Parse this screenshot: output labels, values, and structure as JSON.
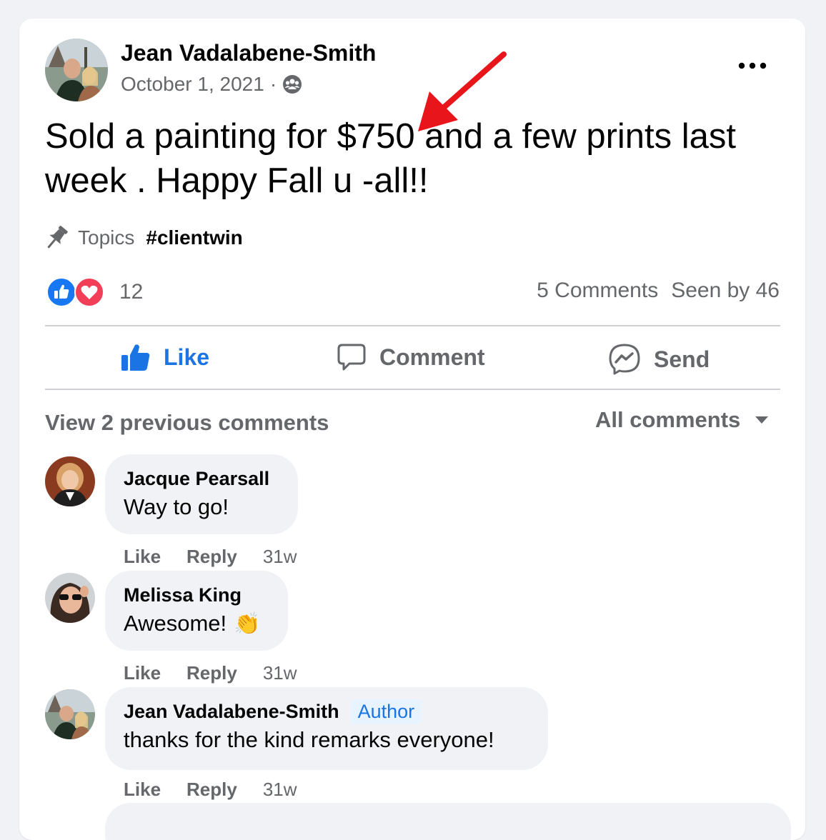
{
  "post": {
    "author": "Jean Vadalabene-Smith",
    "date": "October 1, 2021",
    "separator": "·",
    "privacy_icon": "group-icon",
    "text": "Sold a painting for $750 and a few prints last week . Happy Fall u -all!!",
    "topics_label": "Topics",
    "topic_tag": "#clientwin",
    "reaction_count": "12",
    "reaction_icons": [
      "like-reaction-icon",
      "love-reaction-icon"
    ],
    "comments_count": "5 Comments",
    "seen_by": "Seen by 46"
  },
  "actions": {
    "like": "Like",
    "comment": "Comment",
    "send": "Send"
  },
  "comments_section": {
    "view_previous": "View 2 previous comments",
    "filter": "All comments"
  },
  "comments": [
    {
      "name": "Jacque Pearsall",
      "text": "Way to go!",
      "like": "Like",
      "reply": "Reply",
      "time": "31w"
    },
    {
      "name": "Melissa King",
      "text": "Awesome!",
      "emoji": "👏",
      "like": "Like",
      "reply": "Reply",
      "time": "31w"
    },
    {
      "name": "Jean Vadalabene-Smith",
      "badge": "Author",
      "text": "thanks for the kind remarks everyone!",
      "like": "Like",
      "reply": "Reply",
      "time": "31w"
    }
  ],
  "colors": {
    "accent_blue": "#1b74e4",
    "secondary_text": "#65676b",
    "annotation_red": "#e8161b"
  }
}
